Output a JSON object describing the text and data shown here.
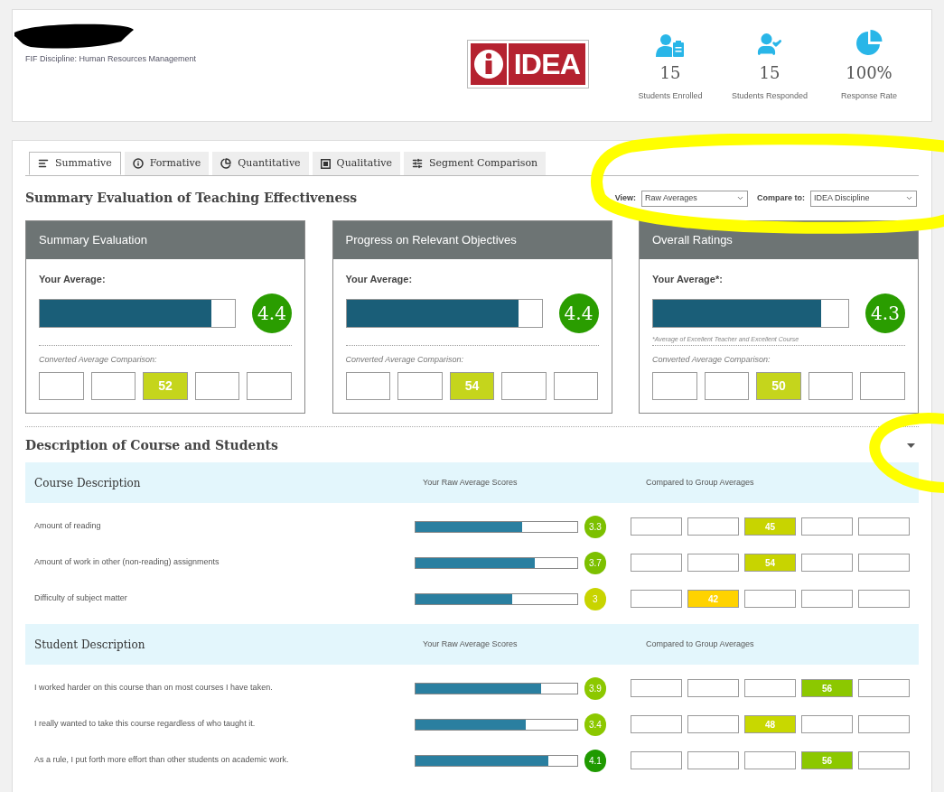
{
  "header": {
    "discipline": "FIF Discipline: Human Resources Management",
    "logo": {
      "word": "IDEA"
    },
    "stats": [
      {
        "kind": "enrolled",
        "value": "15",
        "label": "Students Enrolled"
      },
      {
        "kind": "responded",
        "value": "15",
        "label": "Students Responded"
      },
      {
        "kind": "rate",
        "value": "100%",
        "label": "Response Rate"
      }
    ]
  },
  "tabs": [
    {
      "label": "Summative",
      "selected": true
    },
    {
      "label": "Formative",
      "selected": false
    },
    {
      "label": "Quantitative",
      "selected": false
    },
    {
      "label": "Qualitative",
      "selected": false
    },
    {
      "label": "Segment Comparison",
      "selected": false
    }
  ],
  "summary": {
    "title": "Summary Evaluation of Teaching Effectiveness",
    "view": {
      "label": "View:",
      "value": "Raw Averages"
    },
    "compare": {
      "label": "Compare to:",
      "value": "IDEA Discipline"
    },
    "cards": [
      {
        "title": "Summary Evaluation",
        "average_label": "Your Average:",
        "level": 0.88,
        "score": "4.4",
        "color": "#2a9d00",
        "comparison_label": "Converted Average Comparison:",
        "boxes": [
          {
            "filled": false
          },
          {
            "filled": false
          },
          {
            "filled": true,
            "text": "52",
            "color": "#c5d51c"
          },
          {
            "filled": false
          },
          {
            "filled": false
          }
        ]
      },
      {
        "title": "Progress on Relevant Objectives",
        "average_label": "Your Average:",
        "level": 0.88,
        "score": "4.4",
        "color": "#2a9d00",
        "comparison_label": "Converted Average Comparison:",
        "boxes": [
          {
            "filled": false
          },
          {
            "filled": false
          },
          {
            "filled": true,
            "text": "54",
            "color": "#c5d51c"
          },
          {
            "filled": false
          },
          {
            "filled": false
          }
        ]
      },
      {
        "title": "Overall Ratings",
        "average_label": "Your Average*:",
        "level": 0.86,
        "score": "4.3",
        "color": "#2a9d00",
        "note": "*Average of Excellent Teacher and Excellent Course",
        "comparison_label": "Converted Average Comparison:",
        "boxes": [
          {
            "filled": false
          },
          {
            "filled": false
          },
          {
            "filled": true,
            "text": "50",
            "color": "#c5d51c"
          },
          {
            "filled": false
          },
          {
            "filled": false
          }
        ]
      }
    ]
  },
  "description": {
    "title": "Description of Course and Students",
    "sections": [
      {
        "title": "Course Description",
        "scores_heading": "Your Raw Average Scores",
        "compare_heading": "Compared to Group Averages",
        "rows": [
          {
            "label": "Amount of reading",
            "level": 0.66,
            "score": "3.3",
            "color": "#7cc000",
            "boxes": [
              {
                "filled": false
              },
              {
                "filled": false
              },
              {
                "filled": true,
                "text": "45",
                "color": "#c8d400"
              },
              {
                "filled": false
              },
              {
                "filled": false
              }
            ]
          },
          {
            "label": "Amount of work in other (non-reading) assignments",
            "level": 0.74,
            "score": "3.7",
            "color": "#7cc000",
            "boxes": [
              {
                "filled": false
              },
              {
                "filled": false
              },
              {
                "filled": true,
                "text": "54",
                "color": "#c8d400"
              },
              {
                "filled": false
              },
              {
                "filled": false
              }
            ]
          },
          {
            "label": "Difficulty of subject matter",
            "level": 0.6,
            "score": "3",
            "color": "#c8d400",
            "boxes": [
              {
                "filled": false
              },
              {
                "filled": true,
                "text": "42",
                "color": "#ffd300"
              },
              {
                "filled": false
              },
              {
                "filled": false
              },
              {
                "filled": false
              }
            ]
          }
        ]
      },
      {
        "title": "Student Description",
        "scores_heading": "Your Raw Average Scores",
        "compare_heading": "Compared to Group Averages",
        "rows": [
          {
            "label": "I worked harder on this course than on most courses I have taken.",
            "level": 0.78,
            "score": "3.9",
            "color": "#8cc800",
            "boxes": [
              {
                "filled": false
              },
              {
                "filled": false
              },
              {
                "filled": false
              },
              {
                "filled": true,
                "text": "56",
                "color": "#8cc800"
              },
              {
                "filled": false
              }
            ]
          },
          {
            "label": "I really wanted to take this course regardless of who taught it.",
            "level": 0.68,
            "score": "3.4",
            "color": "#8cc800",
            "boxes": [
              {
                "filled": false
              },
              {
                "filled": false
              },
              {
                "filled": true,
                "text": "48",
                "color": "#c8d800"
              },
              {
                "filled": false
              },
              {
                "filled": false
              }
            ]
          },
          {
            "label": "As a rule, I put forth more effort than other students on academic work.",
            "level": 0.82,
            "score": "4.1",
            "color": "#1f9a00",
            "boxes": [
              {
                "filled": false
              },
              {
                "filled": false
              },
              {
                "filled": false
              },
              {
                "filled": true,
                "text": "56",
                "color": "#8cc800"
              },
              {
                "filled": false
              }
            ]
          }
        ]
      }
    ]
  }
}
